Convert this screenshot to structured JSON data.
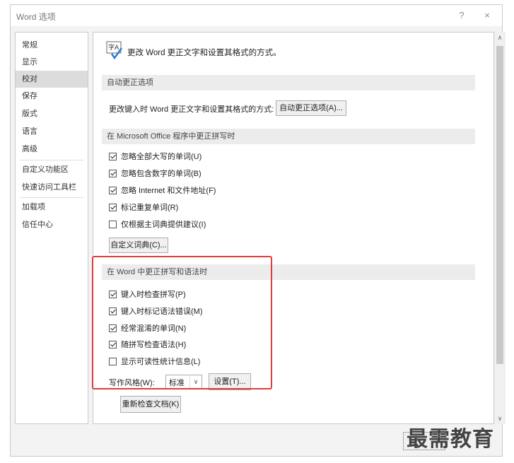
{
  "window": {
    "title": "Word 选项",
    "help_label": "?",
    "close_label": "×"
  },
  "sidebar": {
    "items": [
      {
        "label": "常规"
      },
      {
        "label": "显示"
      },
      {
        "label": "校对"
      },
      {
        "label": "保存"
      },
      {
        "label": "版式"
      },
      {
        "label": "语言"
      },
      {
        "label": "高级"
      },
      {
        "label": "自定义功能区"
      },
      {
        "label": "快速访问工具栏"
      },
      {
        "label": "加载项"
      },
      {
        "label": "信任中心"
      }
    ],
    "selected": "校对"
  },
  "header": {
    "icon": "abc-spellcheck-icon",
    "text": "更改 Word 更正文字和设置其格式的方式。"
  },
  "autocorrect": {
    "section_title": "自动更正选项",
    "description": "更改键入时 Word 更正文字和设置其格式的方式:",
    "button_label": "自动更正选项(A)..."
  },
  "office_spelling": {
    "section_title": "在 Microsoft Office 程序中更正拼写时",
    "options": [
      {
        "label": "忽略全部大写的单词(U)",
        "checked": true
      },
      {
        "label": "忽略包含数字的单词(B)",
        "checked": true
      },
      {
        "label": "忽略 Internet 和文件地址(F)",
        "checked": true
      },
      {
        "label": "标记重复单词(R)",
        "checked": true
      },
      {
        "label": "仅根据主词典提供建议(I)",
        "checked": false
      }
    ],
    "custom_dict_button": "自定义词典(C)..."
  },
  "word_spelling": {
    "section_title": "在 Word 中更正拼写和语法时",
    "options": [
      {
        "label": "键入时检查拼写(P)",
        "checked": true
      },
      {
        "label": "键入时标记语法错误(M)",
        "checked": true
      },
      {
        "label": "经常混淆的单词(N)",
        "checked": true
      },
      {
        "label": "随拼写检查语法(H)",
        "checked": true
      },
      {
        "label": "显示可读性统计信息(L)",
        "checked": false
      }
    ],
    "style_label": "写作风格(W):",
    "style_value": "标准",
    "settings_button": "设置(T)...",
    "recheck_button": "重新检查文档(K)"
  },
  "watermark": "最需教育",
  "colors": {
    "highlight": "#e23b3b",
    "selected_bg": "#dcdcdc"
  }
}
